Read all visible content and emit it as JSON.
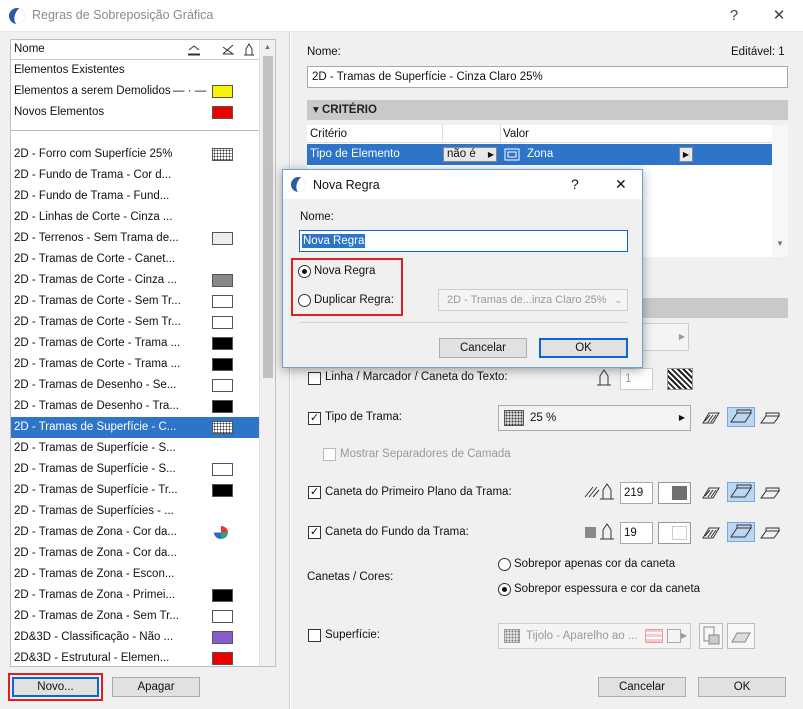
{
  "window": {
    "title": "Regras de Sobreposição Gráfica",
    "help": "?",
    "close": "✕"
  },
  "list": {
    "header": "Nome",
    "fixed": [
      {
        "label": "Elementos Existentes",
        "swatch": ""
      },
      {
        "label": "Elementos a serem Demolidos",
        "swatch": "#f5f500"
      },
      {
        "label": "Novos Elementos",
        "swatch": "#ee0000"
      }
    ],
    "items": [
      {
        "label": "2D - Forro com Superfície 25%",
        "swatch": "dots"
      },
      {
        "label": "2D - Fundo de Trama - Cor d...",
        "swatch": ""
      },
      {
        "label": "2D - Fundo de Trama - Fund...",
        "swatch": ""
      },
      {
        "label": "2D - Linhas de Corte - Cinza ...",
        "swatch": ""
      },
      {
        "label": "2D - Terrenos - Sem Trama de...",
        "swatch": "#eeeeee"
      },
      {
        "label": "2D - Tramas de Corte - Canet...",
        "swatch": ""
      },
      {
        "label": "2D - Tramas de Corte - Cinza ...",
        "swatch": "#888888"
      },
      {
        "label": "2D - Tramas de Corte - Sem Tr...",
        "swatch": "#ffffff"
      },
      {
        "label": "2D - Tramas de Corte - Sem Tr...",
        "swatch": "#ffffff"
      },
      {
        "label": "2D - Tramas de Corte - Trama ...",
        "swatch": "#000000"
      },
      {
        "label": "2D - Tramas de Corte - Trama ...",
        "swatch": "#000000"
      },
      {
        "label": "2D - Tramas de Desenho - Se...",
        "swatch": "#ffffff"
      },
      {
        "label": "2D - Tramas de Desenho - Tra...",
        "swatch": "#000000"
      },
      {
        "label": "2D - Tramas de Superfície - C...",
        "swatch": "dots",
        "selected": true
      },
      {
        "label": "2D - Tramas de Superfície - S...",
        "swatch": ""
      },
      {
        "label": "2D - Tramas de Superfície - S...",
        "swatch": "#ffffff"
      },
      {
        "label": "2D - Tramas de Superfície - Tr...",
        "swatch": "#000000"
      },
      {
        "label": "2D - Tramas de Superfícies - ...",
        "swatch": ""
      },
      {
        "label": "2D - Tramas de Zona - Cor da...",
        "swatch": "pie"
      },
      {
        "label": "2D - Tramas de Zona - Cor da...",
        "swatch": ""
      },
      {
        "label": "2D - Tramas de Zona - Escon...",
        "swatch": ""
      },
      {
        "label": "2D - Tramas de Zona - Primei...",
        "swatch": "#000000"
      },
      {
        "label": "2D - Tramas de Zona - Sem Tr...",
        "swatch": "#ffffff"
      },
      {
        "label": "2D&3D - Classificação - Não ...",
        "swatch": "#8a5cd0"
      },
      {
        "label": "2D&3D - Estrutural - Elemen...",
        "swatch": "#ee0000"
      }
    ],
    "new_button": "Novo...",
    "delete_button": "Apagar"
  },
  "detail": {
    "name_label": "Nome:",
    "editable_label": "Editável: 1",
    "name_value": "2D - Tramas de Superfície - Cinza Claro 25%",
    "criteria_section": "CRITÉRIO",
    "criteria_col1": "Critério",
    "criteria_col2": "Valor",
    "criteria_row": {
      "criterion": "Tipo de Elemento",
      "operator": "não é",
      "value": "Zona"
    },
    "line_marker": "Linha / Marcador / Caneta do Texto:",
    "line_pen_value": "1",
    "fill_type": "Tipo de Trama:",
    "fill_type_value": "25 %",
    "show_separators": "Mostrar Separadores de Camada",
    "fg_pen": "Caneta do Primeiro Plano da Trama:",
    "fg_pen_value": "219",
    "bg_pen": "Caneta do Fundo da Trama:",
    "bg_pen_value": "19",
    "pens_colors": "Canetas / Cores:",
    "radio_color_only": "Sobrepor apenas cor da caneta",
    "radio_weight_color": "Sobrepor espessura e cor da caneta",
    "surface": "Superfície:",
    "surface_value": "Tijolo - Aparelho ao ...",
    "cancel_button": "Cancelar",
    "ok_button": "OK"
  },
  "dialog": {
    "title": "Nova Regra",
    "help": "?",
    "close": "✕",
    "name_label": "Nome:",
    "name_value": "Nova Regra",
    "radio_new": "Nova Regra",
    "radio_duplicate": "Duplicar Regra:",
    "duplicate_value": "2D - Tramas de...inza Claro 25%",
    "cancel_button": "Cancelar",
    "ok_button": "OK"
  }
}
